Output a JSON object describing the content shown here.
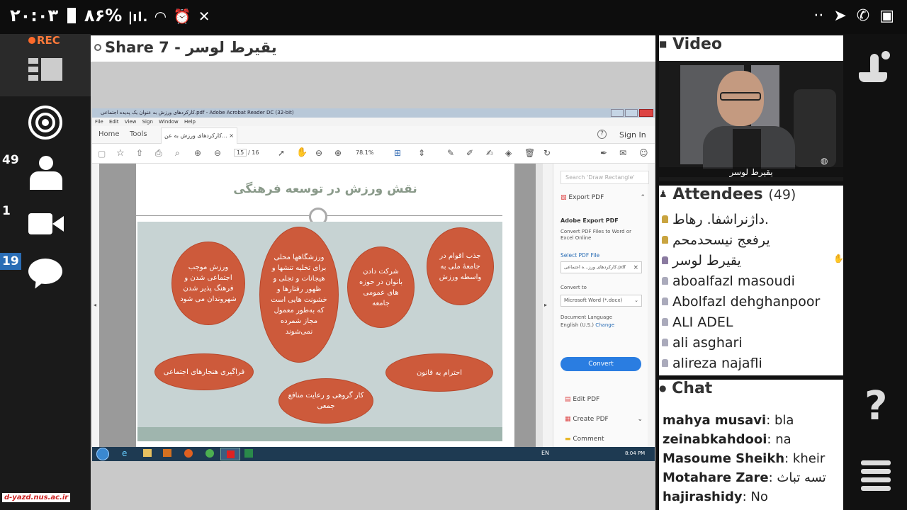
{
  "status_bar": {
    "time": "۲۰:۰۳",
    "battery": "۸۶%",
    "icons": [
      "battery-icon",
      "signal-icon",
      "wifi-icon",
      "alarm-icon",
      "mute-icon",
      "dots-icon",
      "telegram-icon",
      "whatsapp-icon",
      "gallery-icon"
    ]
  },
  "sidebar": {
    "rec_label": "REC",
    "attendees_count": "49",
    "camera_count": "1",
    "chat_count": "19",
    "watermark": "d-yazd.nus.ac.ir"
  },
  "share": {
    "title": "Share 7 - یقیرط لوسر"
  },
  "acrobat": {
    "window_title": "کارکردهای ورزش به عنوان یک پدیده اجتماعی.pdf - Adobe Acrobat Reader DC (32-bit)",
    "menu": [
      "File",
      "Edit",
      "View",
      "Sign",
      "Window",
      "Help"
    ],
    "tabs": [
      "Home",
      "Tools",
      "کارکردهای ورزش به عن..."
    ],
    "sign_in": "Sign In",
    "page_current": "15",
    "page_total": "/ 16",
    "zoom": "78.1%",
    "search_placeholder": "Search 'Draw Rectangle'",
    "export_pdf": "Export PDF",
    "adobe_export_title": "Adobe Export PDF",
    "adobe_export_desc": "Convert PDF Files to Word or Excel Online",
    "select_pdf": "Select PDF File",
    "selected_file": "کارکردهای ورز...ه اجتماعی.pdf",
    "convert_to": "Convert to",
    "convert_format": "Microsoft Word (*.docx)",
    "doc_language": "Document Language",
    "doc_language_value": "English (U.S.)",
    "change": "Change",
    "convert_button": "Convert",
    "edit_pdf": "Edit PDF",
    "create_pdf": "Create PDF",
    "comment": "Comment",
    "taskbar_lang": "EN",
    "taskbar_time": "8:04 PM"
  },
  "slide": {
    "title": "نقش ورزش در توسعه فرهنگی",
    "bubbles": [
      "جذب اقوام در جامعهٔ ملی به واسطه ورزش",
      "شرکت دادن بانوان در حوزه های عمومی جامعه",
      "ورزشگاهها محلی برای تخلیه تنشها و هیجانات و تجلی و ظهور رفتارها و خشونت هایی است که به‌طور معمول مجاز شمرده نمی‌شوند",
      "ورزش موجب اجتماعی شدن و فرهنگ پذیر شدن شهروندان می شود",
      "فراگیری هنجارهای اجتماعی",
      "کار گروهی و رعایت منافع جمعی",
      "احترام به قانون"
    ]
  },
  "video": {
    "title": "Video",
    "name": "یقیرط لوسر"
  },
  "attendees": {
    "title": "Attendees",
    "count": "(49)",
    "list": [
      "داژنراشفا. رهاط.",
      "یرفعج نیسحدمحم",
      "یقیرط لوسر",
      "aboalfazl masoudi",
      "Abolfazl dehghanpoor",
      "ALI  ADEL",
      "ali asghari",
      "alireza najafli"
    ]
  },
  "chat": {
    "title": "Chat",
    "messages": [
      {
        "user": "mahya musavi",
        "text": "bla"
      },
      {
        "user": "zeinabkahdooi",
        "text": "na"
      },
      {
        "user": "Masoume Sheikh",
        "text": "kheir"
      },
      {
        "user": "Motahare Zare",
        "text": "تسه تباث"
      },
      {
        "user": "hajirashidy",
        "text": "No"
      }
    ]
  }
}
